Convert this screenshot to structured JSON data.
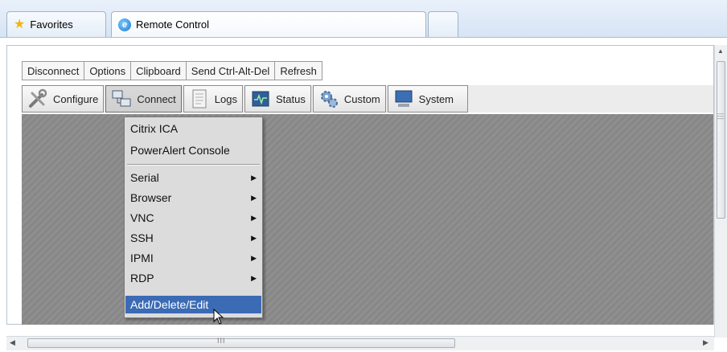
{
  "browser": {
    "tabs": [
      {
        "label": "Favorites",
        "icon": "star-icon"
      },
      {
        "label": "Remote Control",
        "icon": "ie-icon"
      },
      {
        "label": ""
      }
    ]
  },
  "toolbar_text": {
    "buttons": [
      "Disconnect",
      "Options",
      "Clipboard",
      "Send Ctrl-Alt-Del",
      "Refresh"
    ]
  },
  "toolbar_icons": {
    "buttons": [
      {
        "label": "Configure",
        "icon": "tools-icon"
      },
      {
        "label": "Connect",
        "icon": "connect-icon",
        "pressed": true
      },
      {
        "label": "Logs",
        "icon": "document-icon"
      },
      {
        "label": "Status",
        "icon": "status-monitor-icon"
      },
      {
        "label": "Custom",
        "icon": "gears-icon"
      },
      {
        "label": "System",
        "icon": "computer-icon"
      }
    ]
  },
  "connect_menu": {
    "group1": [
      "Citrix ICA",
      "PowerAlert Console"
    ],
    "group2": [
      {
        "label": "Serial",
        "submenu": true
      },
      {
        "label": "Browser",
        "submenu": true
      },
      {
        "label": "VNC",
        "submenu": true
      },
      {
        "label": "SSH",
        "submenu": true
      },
      {
        "label": "IPMI",
        "submenu": true
      },
      {
        "label": "RDP",
        "submenu": true
      },
      {
        "label": "Add/Delete/Edit",
        "submenu": false,
        "highlighted": true
      }
    ]
  },
  "scrollbar": {
    "grip_glyph": "III"
  },
  "colors": {
    "menu_highlight": "#3c6bb5",
    "content_stripes": "#8f8f8f"
  }
}
